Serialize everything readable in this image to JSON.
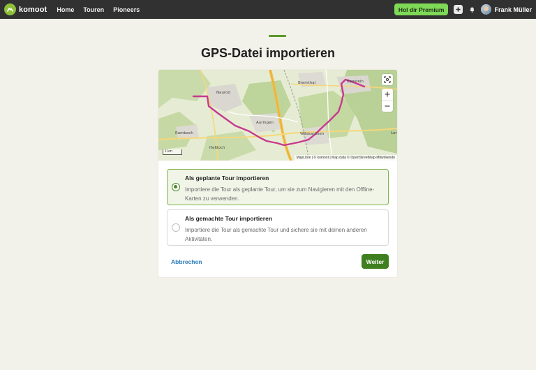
{
  "nav": {
    "brand": "komoot",
    "links": [
      "Home",
      "Touren",
      "Pioneers"
    ],
    "premium_label": "Hol dir Premium",
    "user_name": "Frank Müller"
  },
  "page": {
    "title": "GPS-Datei importieren"
  },
  "map": {
    "places": [
      "Naurod",
      "Bremthal",
      "Eppstein",
      "Auringen",
      "Wildsachsen",
      "Rambach",
      "Heßloch",
      "Lor"
    ],
    "scale_label": "1 km",
    "attribution": "MapLibre | © komoot | Map data © OpenStreetMap-Mitwirkende",
    "route_color": "#c8398f"
  },
  "options": [
    {
      "title": "Als geplante Tour importieren",
      "description": "Importiere die Tour als geplante Tour, um sie zum Navigieren mit den Offline-Karten zu verwenden.",
      "selected": true
    },
    {
      "title": "Als gemachte Tour importieren",
      "description": "Importiere die Tour als gemachte Tour und sichere sie mit deinen anderen Aktivitäten.",
      "selected": false
    }
  ],
  "actions": {
    "cancel_label": "Abbrechen",
    "next_label": "Weiter"
  },
  "colors": {
    "accent": "#5a9a2a",
    "primary_button": "#3f7f1f",
    "premium_button": "#7ed957",
    "topbar": "#313131"
  }
}
